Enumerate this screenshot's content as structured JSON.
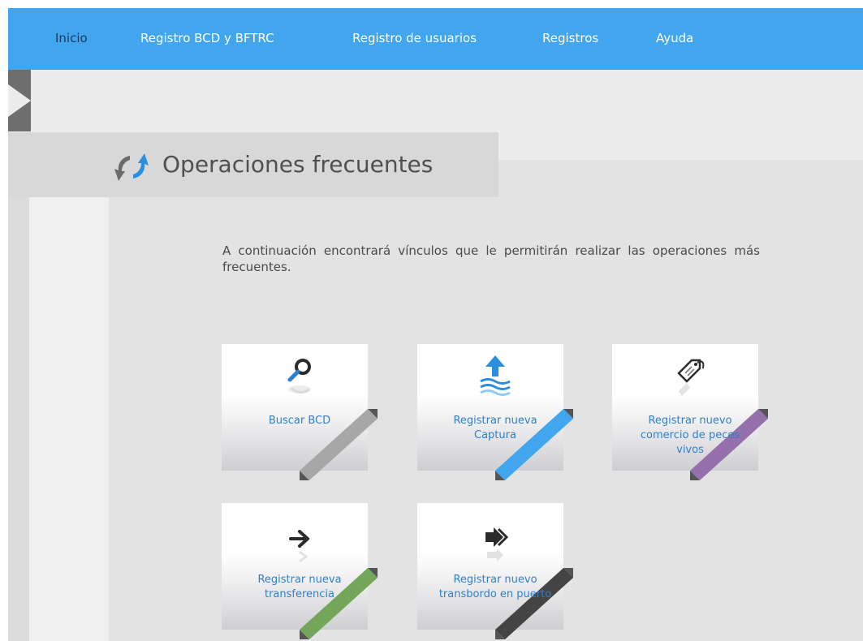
{
  "nav": {
    "items": [
      {
        "label": "Inicio",
        "active": true
      },
      {
        "label": "Registro BCD y BFTRC",
        "active": false
      },
      {
        "label": "Registro de usuarios",
        "active": false
      },
      {
        "label": "Registros",
        "active": false
      },
      {
        "label": "Ayuda",
        "active": false
      }
    ]
  },
  "page": {
    "title": "Operaciones frecuentes",
    "title_icon": "sync-arrows-icon",
    "intro": "A continuación encontrará vínculos que le permitirán realizar las operaciones más frecuentes."
  },
  "tiles": [
    {
      "label_lines": [
        "Buscar BCD"
      ],
      "icon": "magnifier-icon",
      "ribbon_color": "#a7a7a7"
    },
    {
      "label_lines": [
        "Registrar nueva",
        "Captura"
      ],
      "icon": "catch-upload-icon",
      "ribbon_color": "#42a6ee"
    },
    {
      "label_lines": [
        "Registrar nuevo",
        "comercio de peces",
        "vivos"
      ],
      "icon": "tag-icon",
      "ribbon_color": "#9670ad"
    },
    {
      "label_lines": [
        "Registrar nueva",
        "transferencia"
      ],
      "icon": "arrow-right-icon",
      "ribbon_color": "#74a65a"
    },
    {
      "label_lines": [
        "Registrar nuevo",
        "transbordo en puerto"
      ],
      "icon": "double-arrow-icon",
      "ribbon_color": "#444444"
    }
  ],
  "colors": {
    "topbar": "#42a6ee",
    "nav_text": "#ffffff",
    "nav_active_text": "#1c3a63",
    "tile_link": "#2f7fc9"
  }
}
